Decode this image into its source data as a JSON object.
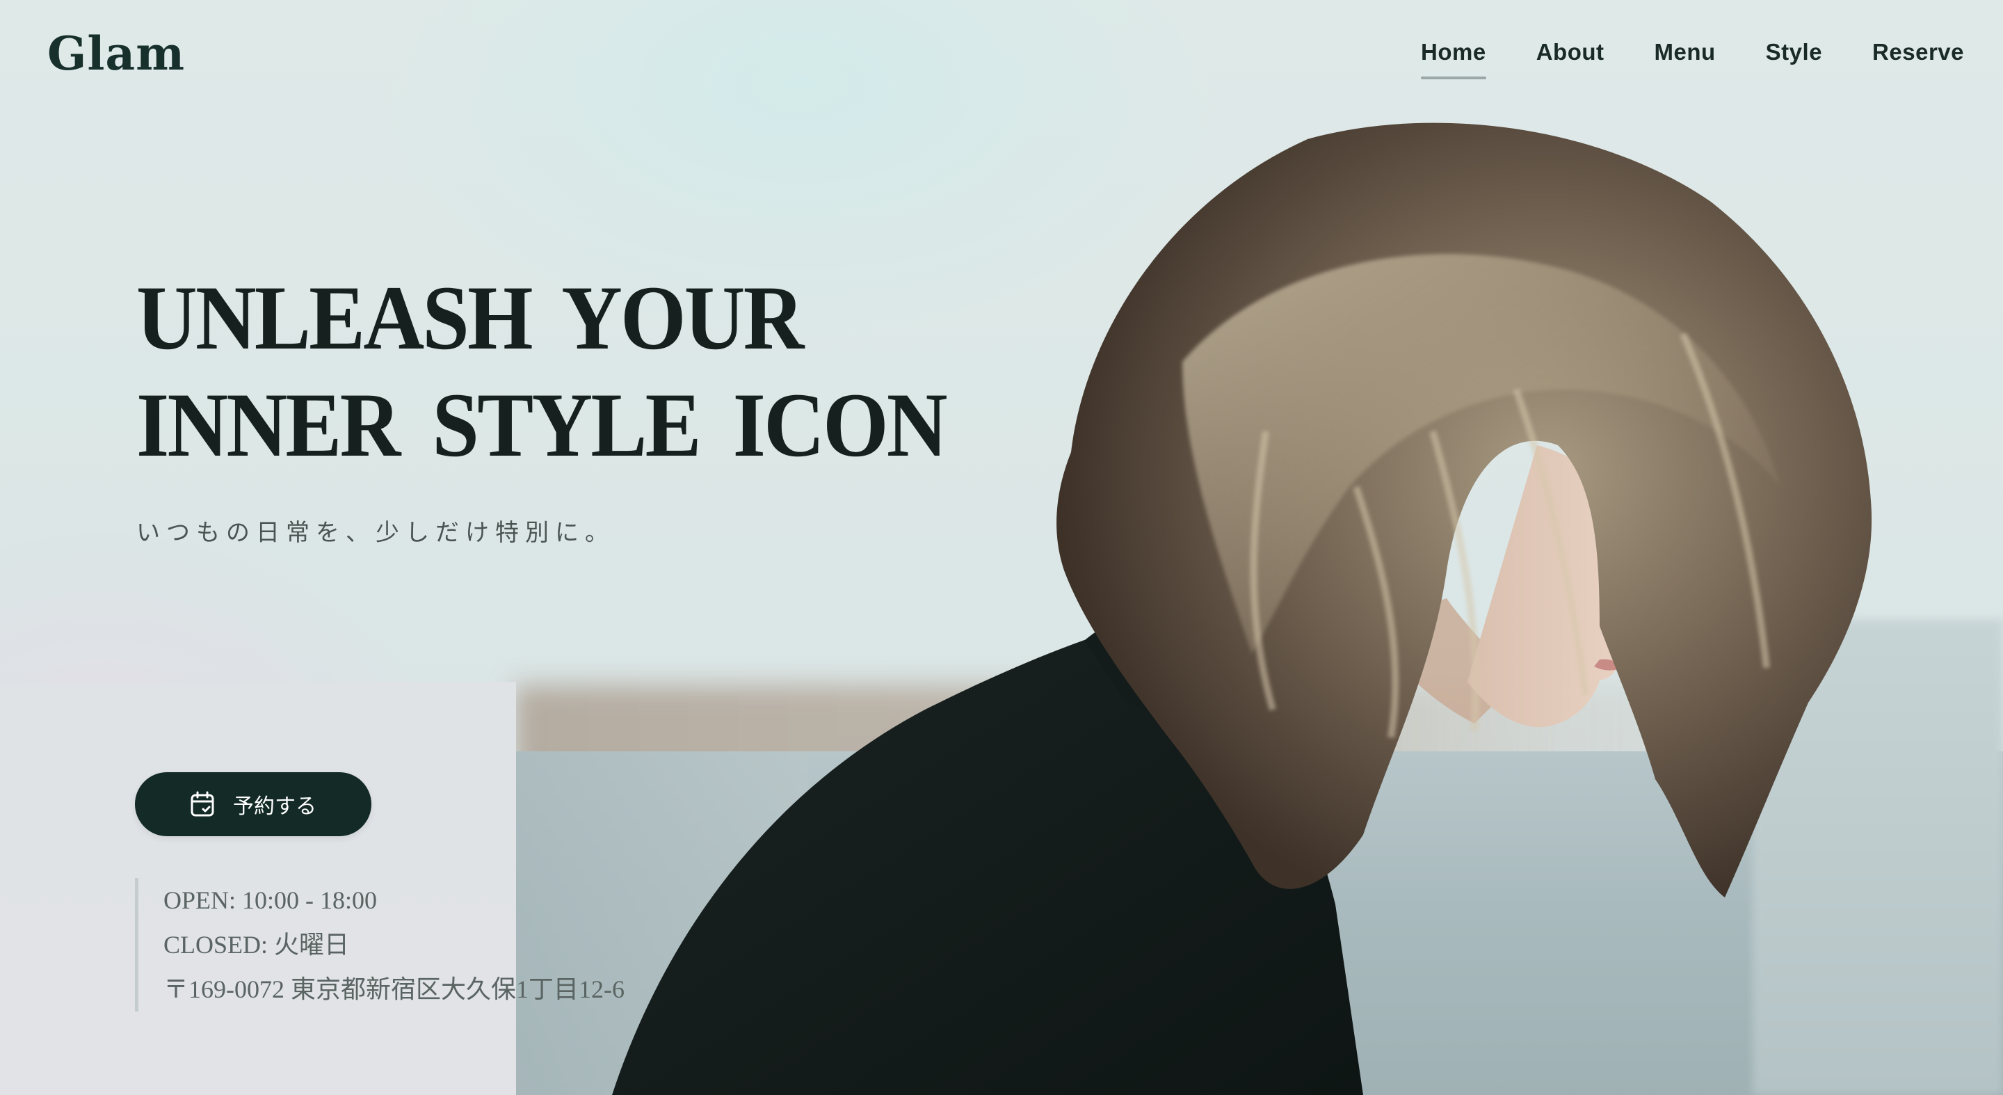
{
  "header": {
    "logo": "Glam",
    "nav": [
      {
        "label": "Home",
        "active": true
      },
      {
        "label": "About",
        "active": false
      },
      {
        "label": "Menu",
        "active": false
      },
      {
        "label": "Style",
        "active": false
      },
      {
        "label": "Reserve",
        "active": false
      }
    ]
  },
  "hero": {
    "headline_line1": "UNLEASH YOUR",
    "headline_line2": "INNER STYLE ICON",
    "tagline": "いつもの日常を、少しだけ特別に。",
    "reserve_button": {
      "label": "予約する",
      "icon": "calendar-icon"
    },
    "info": {
      "hours": "OPEN: 10:00 - 18:00",
      "closed": "CLOSED: 火曜日",
      "address": "〒169-0072 東京都新宿区大久保1丁目12-6"
    }
  },
  "colors": {
    "primary": "#132a26",
    "text": "#16211f",
    "muted": "#5a6462",
    "background": "#dfe6e6"
  }
}
